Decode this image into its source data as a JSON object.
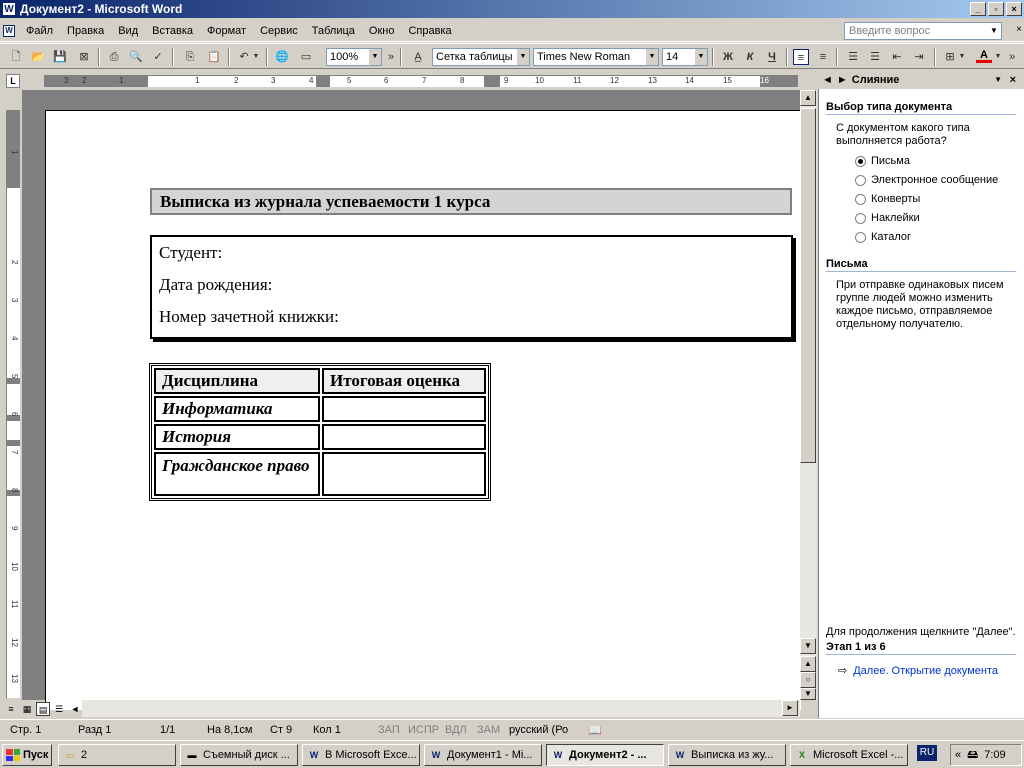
{
  "window": {
    "title": "Документ2 - Microsoft Word",
    "app_icon": "W"
  },
  "menu": {
    "items": [
      "Файл",
      "Правка",
      "Вид",
      "Вставка",
      "Формат",
      "Сервис",
      "Таблица",
      "Окно",
      "Справка"
    ],
    "ask_placeholder": "Введите вопрос"
  },
  "toolbar": {
    "zoom": "100%",
    "style": "Сетка таблицы",
    "font": "Times New Roman",
    "size": "14",
    "bold": "Ж",
    "italic": "К",
    "underline": "Ч",
    "font_color_letter": "A"
  },
  "ruler": {
    "h_ticks": [
      "3",
      "2",
      "1",
      "1",
      "2",
      "3",
      "4",
      "5",
      "6",
      "7",
      "8",
      "9",
      "10",
      "11",
      "12",
      "13",
      "14",
      "15",
      "16"
    ],
    "v_ticks": [
      "1",
      "2",
      "3",
      "4",
      "5",
      "6",
      "7",
      "8",
      "9",
      "10",
      "11",
      "12",
      "13"
    ],
    "corner": "L"
  },
  "document": {
    "heading": "Выписка из журнала успеваемости 1 курса",
    "info_lines": [
      "Студент:",
      "Дата рождения:",
      "Номер зачетной книжки:"
    ],
    "table": {
      "headers": [
        "Дисциплина",
        "Итоговая оценка"
      ],
      "rows": [
        [
          "Информатика",
          ""
        ],
        [
          "История",
          ""
        ],
        [
          "Гражданское право",
          ""
        ]
      ]
    }
  },
  "task_pane": {
    "title": "Слияние",
    "section_type": "Выбор типа документа",
    "question": "С документом какого типа выполняется работа?",
    "options": [
      {
        "label": "Письма",
        "selected": true
      },
      {
        "label": "Электронное сообщение",
        "selected": false
      },
      {
        "label": "Конверты",
        "selected": false
      },
      {
        "label": "Наклейки",
        "selected": false
      },
      {
        "label": "Каталог",
        "selected": false
      }
    ],
    "section_letters": "Письма",
    "letters_desc": "При отправке одинаковых писем группе людей можно изменить каждое письмо, отправляемое отдельному получателю.",
    "continue_text": "Для продолжения щелкните \"Далее\".",
    "step": "Этап 1 из 6",
    "next_link": "Далее. Открытие документа"
  },
  "status": {
    "page": "Стр. 1",
    "section": "Разд 1",
    "pages": "1/1",
    "at": "На 8,1см",
    "line": "Ст 9",
    "col": "Кол 1",
    "rec": "ЗАП",
    "trk": "ИСПР",
    "ext": "ВДЛ",
    "ovr": "ЗАМ",
    "lang": "русский (Ро"
  },
  "taskbar": {
    "start": "Пуск",
    "tasks": [
      "2",
      "Съемный диск ...",
      "В Microsoft Exce...",
      "Документ1 - Mi...",
      "Документ2 - ...",
      "Выписка из жу...",
      "Microsoft Excel -..."
    ],
    "lang": "RU",
    "clock": "7:09"
  }
}
